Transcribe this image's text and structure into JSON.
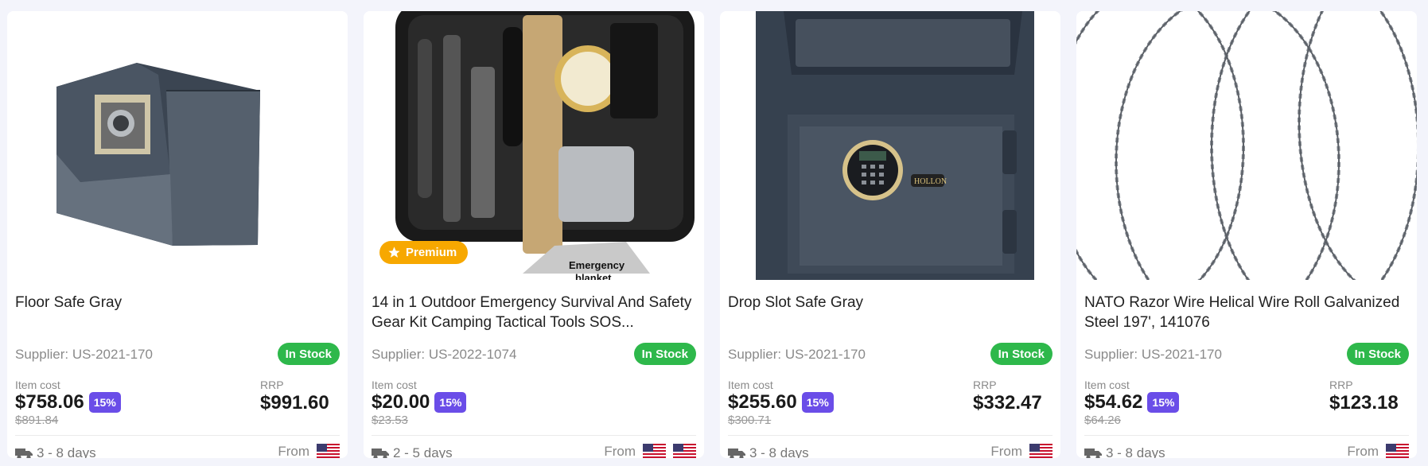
{
  "products": [
    {
      "title": "Floor Safe Gray",
      "supplier": "Supplier: US-2021-170",
      "stock": "In Stock",
      "cost_label": "Item cost",
      "price": "$758.06",
      "discount": "15%",
      "old_price": "$891.84",
      "rrp_label": "RRP",
      "rrp": "$991.60",
      "shipping": "3 - 8 days",
      "from": "From",
      "image": "floor-safe-image",
      "premium": false
    },
    {
      "title": "14 in 1 Outdoor Emergency Survival And Safety Gear Kit Camping Tactical Tools SOS...",
      "supplier": "Supplier: US-2022-1074",
      "stock": "In Stock",
      "cost_label": "Item cost",
      "price": "$20.00",
      "discount": "15%",
      "old_price": "$23.53",
      "rrp_label": "",
      "rrp": "",
      "shipping": "2 - 5 days",
      "from": "From",
      "image": "survival-kit-image",
      "premium": true,
      "premium_label": "Premium",
      "image_text_1": "Emergency",
      "image_text_2": "blanket"
    },
    {
      "title": "Drop Slot Safe Gray",
      "supplier": "Supplier: US-2021-170",
      "stock": "In Stock",
      "cost_label": "Item cost",
      "price": "$255.60",
      "discount": "15%",
      "old_price": "$300.71",
      "rrp_label": "RRP",
      "rrp": "$332.47",
      "shipping": "3 - 8 days",
      "from": "From",
      "image": "drop-slot-safe-image",
      "premium": false,
      "image_text_1": "HOLLON"
    },
    {
      "title": "NATO Razor Wire Helical Wire Roll Galvanized Steel 197', 141076",
      "supplier": "Supplier: US-2021-170",
      "stock": "In Stock",
      "cost_label": "Item cost",
      "price": "$54.62",
      "discount": "15%",
      "old_price": "$64.26",
      "rrp_label": "RRP",
      "rrp": "$123.18",
      "shipping": "3 - 8 days",
      "from": "From",
      "image": "razor-wire-image",
      "premium": false
    }
  ],
  "colors": {
    "stock": "#2eb84b",
    "discount": "#6a4de8",
    "premium": "#f7a800"
  }
}
